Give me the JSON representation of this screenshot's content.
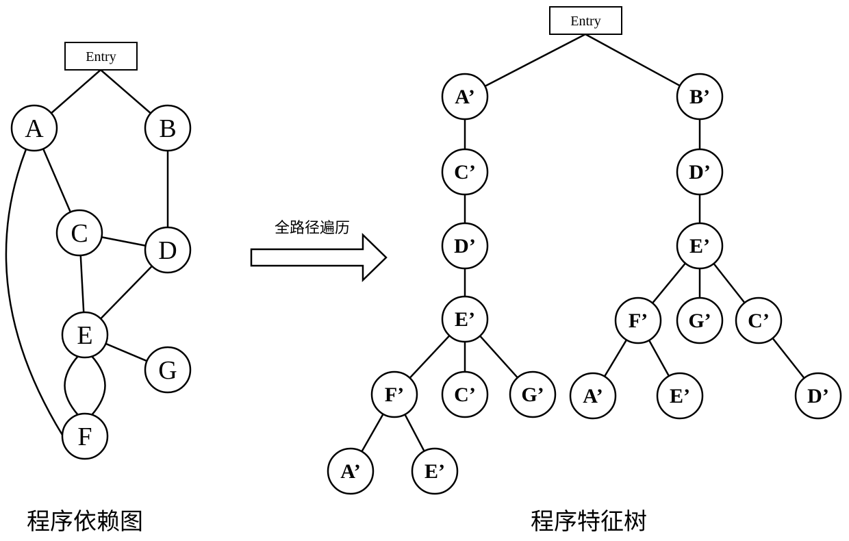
{
  "left_graph": {
    "caption": "程序依赖图",
    "entry_label": "Entry",
    "nodes": [
      {
        "id": "A",
        "label": "A"
      },
      {
        "id": "B",
        "label": "B"
      },
      {
        "id": "C",
        "label": "C"
      },
      {
        "id": "D",
        "label": "D"
      },
      {
        "id": "E",
        "label": "E"
      },
      {
        "id": "F",
        "label": "F"
      },
      {
        "id": "G",
        "label": "G"
      }
    ],
    "edges": [
      [
        "Entry",
        "A"
      ],
      [
        "Entry",
        "B"
      ],
      [
        "A",
        "C"
      ],
      [
        "A",
        "F"
      ],
      [
        "B",
        "D"
      ],
      [
        "C",
        "D"
      ],
      [
        "C",
        "E"
      ],
      [
        "D",
        "E"
      ],
      [
        "E",
        "G"
      ],
      [
        "E",
        "F"
      ],
      [
        "F",
        "E"
      ]
    ]
  },
  "transform_arrow": {
    "label": "全路径遍历"
  },
  "right_tree": {
    "caption": "程序特征树",
    "entry_label": "Entry",
    "nodes": [
      {
        "id": "a1",
        "label": "A’"
      },
      {
        "id": "c1",
        "label": "C’"
      },
      {
        "id": "d1",
        "label": "D’"
      },
      {
        "id": "e1",
        "label": "E’"
      },
      {
        "id": "f1",
        "label": "F’"
      },
      {
        "id": "c2",
        "label": "C’"
      },
      {
        "id": "g1",
        "label": "G’"
      },
      {
        "id": "a2",
        "label": "A’"
      },
      {
        "id": "e2",
        "label": "E’"
      },
      {
        "id": "b1",
        "label": "B’"
      },
      {
        "id": "d2",
        "label": "D’"
      },
      {
        "id": "e3",
        "label": "E’"
      },
      {
        "id": "f2",
        "label": "F’"
      },
      {
        "id": "g2",
        "label": "G’"
      },
      {
        "id": "c3",
        "label": "C’"
      },
      {
        "id": "a3",
        "label": "A’"
      },
      {
        "id": "e4",
        "label": "E’"
      },
      {
        "id": "d3",
        "label": "D’"
      }
    ],
    "edges": [
      [
        "Entry",
        "a1"
      ],
      [
        "Entry",
        "b1"
      ],
      [
        "a1",
        "c1"
      ],
      [
        "c1",
        "d1"
      ],
      [
        "d1",
        "e1"
      ],
      [
        "e1",
        "f1"
      ],
      [
        "e1",
        "c2"
      ],
      [
        "e1",
        "g1"
      ],
      [
        "f1",
        "a2"
      ],
      [
        "f1",
        "e2"
      ],
      [
        "b1",
        "d2"
      ],
      [
        "d2",
        "e3"
      ],
      [
        "e3",
        "f2"
      ],
      [
        "e3",
        "g2"
      ],
      [
        "e3",
        "c3"
      ],
      [
        "f2",
        "a3"
      ],
      [
        "f2",
        "e4"
      ],
      [
        "c3",
        "d3"
      ]
    ]
  }
}
